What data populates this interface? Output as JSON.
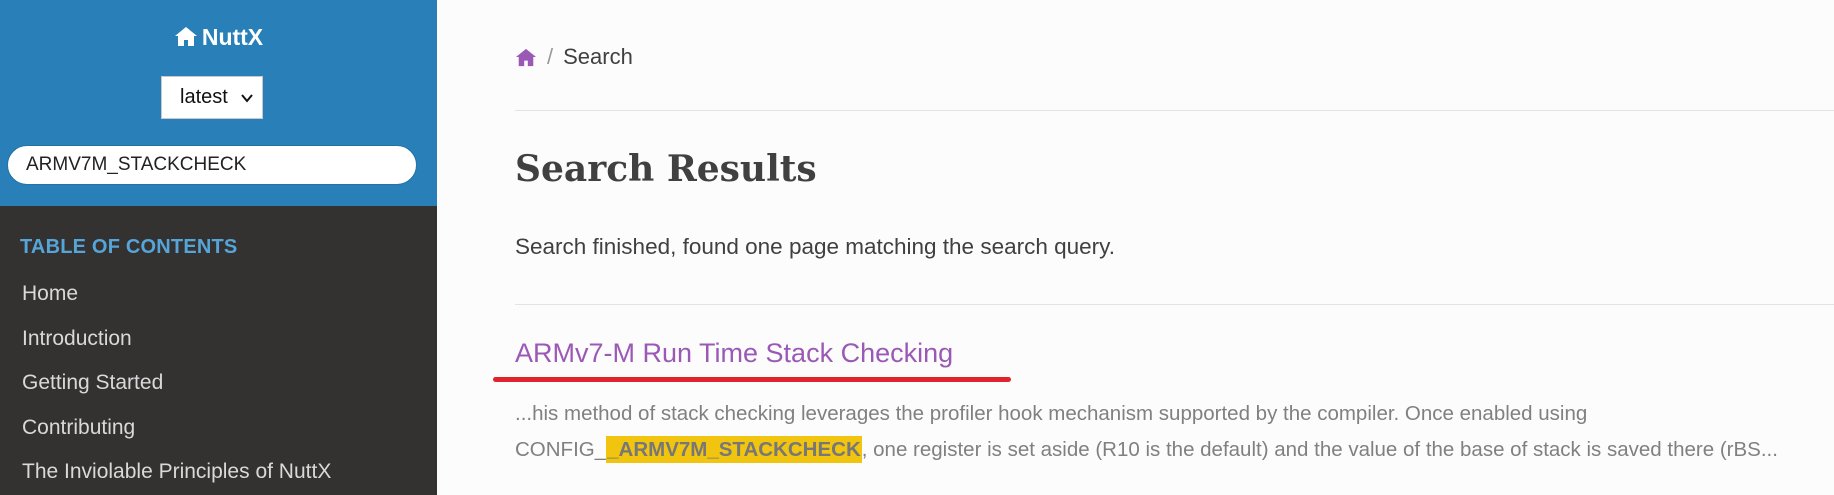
{
  "sidebar": {
    "brand": "NuttX",
    "version": "latest",
    "search_value": "ARMV7M_STACKCHECK",
    "toc_caption": "TABLE OF CONTENTS",
    "toc_items": [
      "Home",
      "Introduction",
      "Getting Started",
      "Contributing",
      "The Inviolable Principles of NuttX"
    ]
  },
  "main": {
    "breadcrumb_current": "Search",
    "title": "Search Results",
    "status": "Search finished, found one page matching the search query.",
    "result": {
      "title": "ARMv7-M Run Time Stack Checking",
      "snippet_line1": "...his method of stack checking leverages the profiler hook mechanism supported by the compiler. Once enabled using",
      "snippet_prefix": "CONFIG_",
      "snippet_highlight": "_ARMV7M_STACKCHECK",
      "snippet_suffix": ", one register is set aside (R10 is the default) and the value of the base of stack is saved there (rBS..."
    }
  },
  "colors": {
    "sidebar_top": "#2980b9",
    "sidebar_bg": "#343131",
    "link_purple": "#9b59b6",
    "highlight": "#f1c40f",
    "annotation_red": "#e0242e"
  }
}
